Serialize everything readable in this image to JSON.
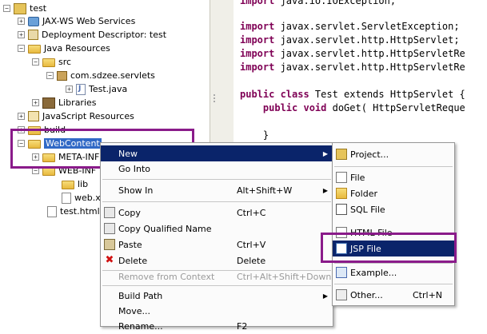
{
  "tree": {
    "items": [
      {
        "label": "test",
        "exp": "-",
        "icon": "project-icon"
      },
      {
        "label": "JAX-WS Web Services",
        "exp": "+",
        "icon": "webservices-icon"
      },
      {
        "label": "Deployment Descriptor: test",
        "exp": "+",
        "icon": "descriptor-icon"
      },
      {
        "label": "Java Resources",
        "exp": "-",
        "icon": "java-resources-icon"
      },
      {
        "label": "src",
        "exp": "-",
        "icon": "source-folder-icon"
      },
      {
        "label": "com.sdzee.servlets",
        "exp": "-",
        "icon": "package-icon"
      },
      {
        "label": "Test.java",
        "exp": "+",
        "icon": "java-file-icon"
      },
      {
        "label": "Libraries",
        "exp": "+",
        "icon": "libraries-icon"
      },
      {
        "label": "JavaScript Resources",
        "exp": "+",
        "icon": "javascript-icon"
      },
      {
        "label": "build",
        "exp": "+",
        "icon": "folder-icon"
      },
      {
        "label": "WebContent",
        "exp": "-",
        "icon": "folder-icon"
      },
      {
        "label": "META-INF",
        "exp": "+",
        "icon": "folder-icon"
      },
      {
        "label": "WEB-INF",
        "exp": "-",
        "icon": "folder-icon"
      },
      {
        "label": "lib",
        "exp": "",
        "icon": "folder-icon"
      },
      {
        "label": "web.x",
        "exp": "",
        "icon": "xml-file-icon"
      },
      {
        "label": "test.html",
        "exp": "",
        "icon": "html-file-icon"
      }
    ]
  },
  "editor": {
    "lines": [
      {
        "kw": "import",
        "rest": " java.io.IOException;"
      },
      {
        "kw": "",
        "rest": ""
      },
      {
        "kw": "import",
        "rest": " javax.servlet.ServletException;"
      },
      {
        "kw": "import",
        "rest": " javax.servlet.http.HttpServlet;"
      },
      {
        "kw": "import",
        "rest": " javax.servlet.http.HttpServletRe"
      },
      {
        "kw": "import",
        "rest": " javax.servlet.http.HttpServletRe"
      },
      {
        "kw": "",
        "rest": ""
      },
      {
        "kw": "public class",
        "rest": " Test extends HttpServlet {"
      },
      {
        "kw": "    public void",
        "rest": " doGet( HttpServletReque"
      },
      {
        "kw": "",
        "rest": ""
      },
      {
        "kw": "",
        "rest": "    }"
      }
    ]
  },
  "context_menu": {
    "items": [
      {
        "label": "New",
        "shortcut": "",
        "arrow": "▶",
        "state": "highlighted"
      },
      {
        "label": "Go Into",
        "shortcut": "",
        "arrow": "",
        "state": "normal"
      },
      {
        "label": "Show In",
        "shortcut": "Alt+Shift+W",
        "arrow": "▶",
        "state": "normal"
      },
      {
        "label": "Copy",
        "shortcut": "Ctrl+C",
        "arrow": "",
        "state": "normal"
      },
      {
        "label": "Copy Qualified Name",
        "shortcut": "",
        "arrow": "",
        "state": "normal"
      },
      {
        "label": "Paste",
        "shortcut": "Ctrl+V",
        "arrow": "",
        "state": "normal"
      },
      {
        "label": "Delete",
        "shortcut": "Delete",
        "arrow": "",
        "state": "normal"
      },
      {
        "label": "Remove from Context",
        "shortcut": "Ctrl+Alt+Shift+Down",
        "arrow": "",
        "state": "disabled"
      },
      {
        "label": "Build Path",
        "shortcut": "",
        "arrow": "▶",
        "state": "normal"
      },
      {
        "label": "Move...",
        "shortcut": "",
        "arrow": "",
        "state": "normal"
      },
      {
        "label": "Rename...",
        "shortcut": "F2",
        "arrow": "",
        "state": "normal"
      }
    ]
  },
  "submenu": {
    "items": [
      {
        "label": "Project...",
        "shortcut": "",
        "state": "normal"
      },
      {
        "label": "File",
        "shortcut": "",
        "state": "normal"
      },
      {
        "label": "Folder",
        "shortcut": "",
        "state": "normal"
      },
      {
        "label": "SQL File",
        "shortcut": "",
        "state": "normal"
      },
      {
        "label": "HTML File",
        "shortcut": "",
        "state": "normal"
      },
      {
        "label": "JSP File",
        "shortcut": "",
        "state": "highlighted"
      },
      {
        "label": "Example...",
        "shortcut": "",
        "state": "normal"
      },
      {
        "label": "Other...",
        "shortcut": "Ctrl+N",
        "state": "normal"
      }
    ]
  },
  "colors": {
    "highlight_box": "#8a1b8a",
    "menu_highlight": "#0a246a",
    "keyword": "#7f0055"
  }
}
